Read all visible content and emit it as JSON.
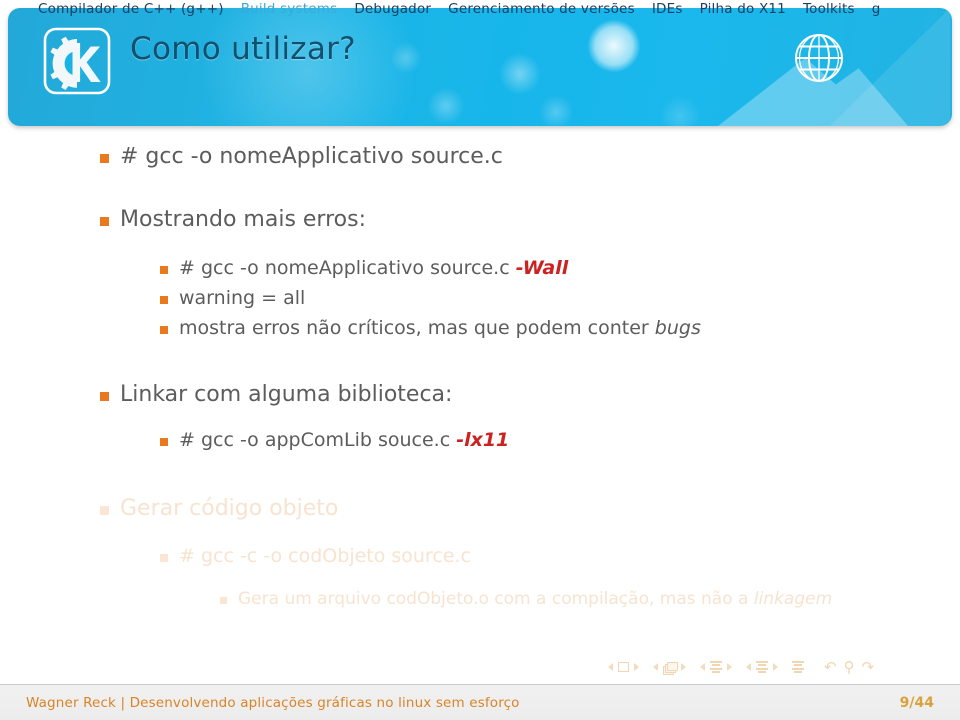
{
  "navbar": {
    "items": [
      {
        "label": "Compilador de C++ (g++)",
        "state": "active"
      },
      {
        "label": "Build systems",
        "state": "dim"
      },
      {
        "label": "Debugador",
        "state": "active"
      },
      {
        "label": "Gerenciamento de versões",
        "state": "active"
      },
      {
        "label": "IDEs",
        "state": "active"
      },
      {
        "label": "Pilha do X11",
        "state": "active"
      },
      {
        "label": "Toolkits",
        "state": "active"
      },
      {
        "label": "g",
        "state": "active"
      }
    ]
  },
  "header": {
    "title": "Como utilizar?",
    "logo_icon": "kde-gear-k-icon",
    "globe_icon": "globe-icon",
    "accent_color": "#18b5e8",
    "title_color": "#11506e"
  },
  "content": {
    "bullet_color": "#e8791e",
    "text_color": "#5c5c5c",
    "highlight_color": "#cc2222",
    "faded_color": "#f7e3cf",
    "items": [
      {
        "level": 1,
        "faded": false,
        "parts": [
          {
            "text": "# gcc -o nomeApplicativo source.c",
            "style": "normal"
          }
        ]
      },
      {
        "level": 1,
        "faded": false,
        "parts": [
          {
            "text": "Mostrando mais erros:",
            "style": "normal"
          }
        ]
      },
      {
        "level": 2,
        "faded": false,
        "parts": [
          {
            "text": "# gcc -o nomeApplicativo source.c ",
            "style": "normal"
          },
          {
            "text": "-Wall",
            "style": "red-italic"
          }
        ]
      },
      {
        "level": 2,
        "faded": false,
        "parts": [
          {
            "text": "warning = all",
            "style": "normal"
          }
        ]
      },
      {
        "level": 2,
        "faded": false,
        "parts": [
          {
            "text": "mostra erros não críticos, mas que podem conter ",
            "style": "normal"
          },
          {
            "text": "bugs",
            "style": "italic"
          }
        ]
      },
      {
        "level": 1,
        "faded": false,
        "parts": [
          {
            "text": "Linkar com alguma biblioteca:",
            "style": "normal"
          }
        ]
      },
      {
        "level": 2,
        "faded": false,
        "parts": [
          {
            "text": "# gcc -o appComLib souce.c ",
            "style": "normal"
          },
          {
            "text": "-lx11",
            "style": "red-italic"
          }
        ]
      },
      {
        "level": 1,
        "faded": true,
        "parts": [
          {
            "text": "Gerar código objeto",
            "style": "normal"
          }
        ]
      },
      {
        "level": 2,
        "faded": true,
        "parts": [
          {
            "text": "# gcc -c -o codObjeto source.c",
            "style": "normal"
          }
        ]
      },
      {
        "level": 3,
        "faded": true,
        "parts": [
          {
            "text": "Gera um arquivo codObjeto.o com a compilação, mas não a ",
            "style": "normal"
          },
          {
            "text": "linkagem",
            "style": "italic"
          }
        ]
      }
    ]
  },
  "nav_symbols": {
    "groups": [
      {
        "icon": "slide-square-icon",
        "prev": "◂",
        "next": "▸"
      },
      {
        "icon": "frames-stack-icon",
        "prev": "◂",
        "next": "▸"
      },
      {
        "icon": "subsection-lines-icon",
        "prev": "◂",
        "next": "▸"
      },
      {
        "icon": "section-lines-icon",
        "prev": "◂",
        "next": "▸"
      }
    ],
    "doc_icon": "document-lines-icon",
    "back_icon": "undo-arrow-icon",
    "search_icon": "search-icon",
    "forward_icon": "redo-arrow-icon"
  },
  "footer": {
    "left": "Wagner Reck | Desenvolvendo aplicações gráficas no linux sem esforço",
    "page": "9/44",
    "text_color": "#d98427"
  }
}
